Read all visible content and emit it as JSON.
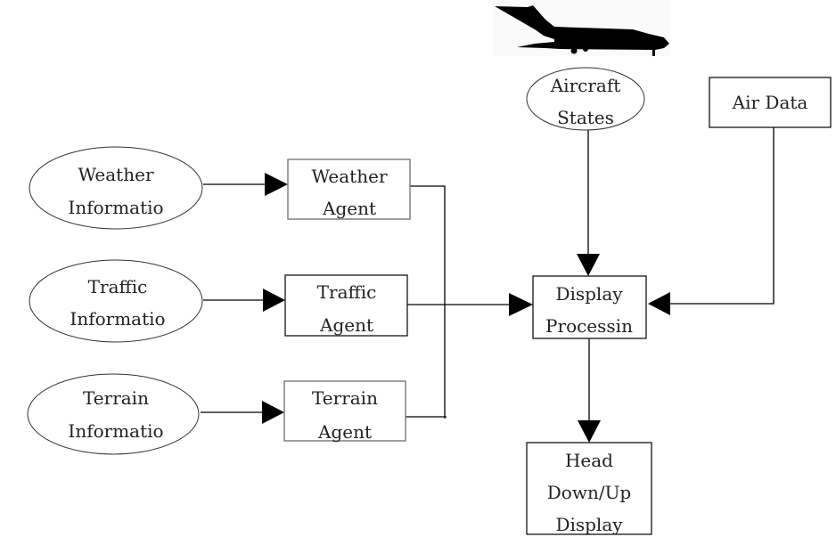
{
  "nodes": {
    "aircraft_states": [
      "Aircraft",
      "States"
    ],
    "air_data": [
      "Air Data"
    ],
    "weather_info": [
      "Weather",
      "Informatio"
    ],
    "traffic_info": [
      "Traffic",
      "Informatio"
    ],
    "terrain_info": [
      "Terrain",
      "Informatio"
    ],
    "weather_agent": [
      "Weather",
      "Agent"
    ],
    "traffic_agent": [
      "Traffic",
      "Agent"
    ],
    "terrain_agent": [
      "Terrain",
      "Agent"
    ],
    "display_processing": [
      "Display",
      "Processin"
    ],
    "head_display": [
      "Head",
      "Down/Up",
      "Display"
    ]
  },
  "icons": {
    "aircraft": "airplane-silhouette-icon"
  }
}
